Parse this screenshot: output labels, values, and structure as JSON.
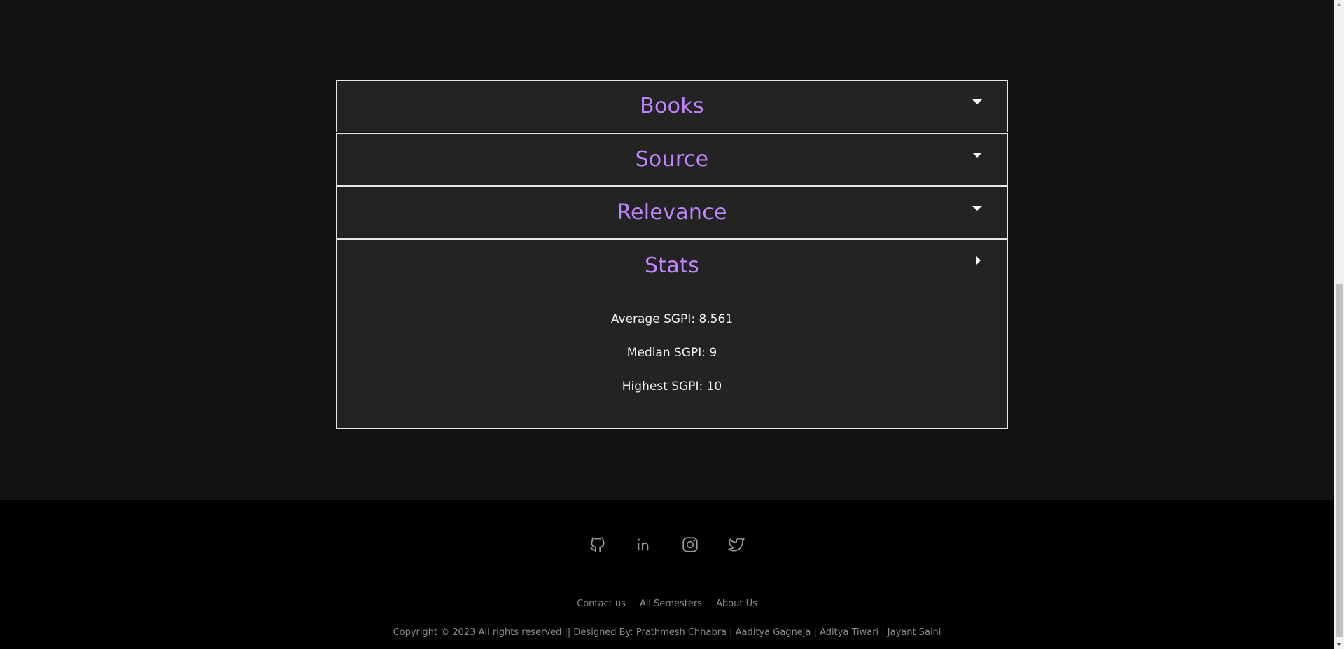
{
  "accordion": {
    "items": [
      {
        "title": "Books",
        "expanded": false
      },
      {
        "title": "Source",
        "expanded": false
      },
      {
        "title": "Relevance",
        "expanded": false
      },
      {
        "title": "Stats",
        "expanded": true
      }
    ],
    "stats": {
      "average": "Average SGPI: 8.561",
      "median": "Median SGPI: 9",
      "highest": "Highest SGPI: 10"
    }
  },
  "footer": {
    "socials": [
      "github-icon",
      "linkedin-icon",
      "instagram-icon",
      "twitter-icon"
    ],
    "links": {
      "contact": "Contact us",
      "semesters": "All Semesters",
      "about": "About Us"
    },
    "copyright": "Copyright © 2023 All rights reserved || Designed By: Prathmesh Chhabra | Aaditya Gagneja | Aditya Tiwari | Jayant Saini"
  },
  "colors": {
    "accent": "#c084fc",
    "background": "#121212",
    "panel": "#232323",
    "footer": "#000000"
  }
}
